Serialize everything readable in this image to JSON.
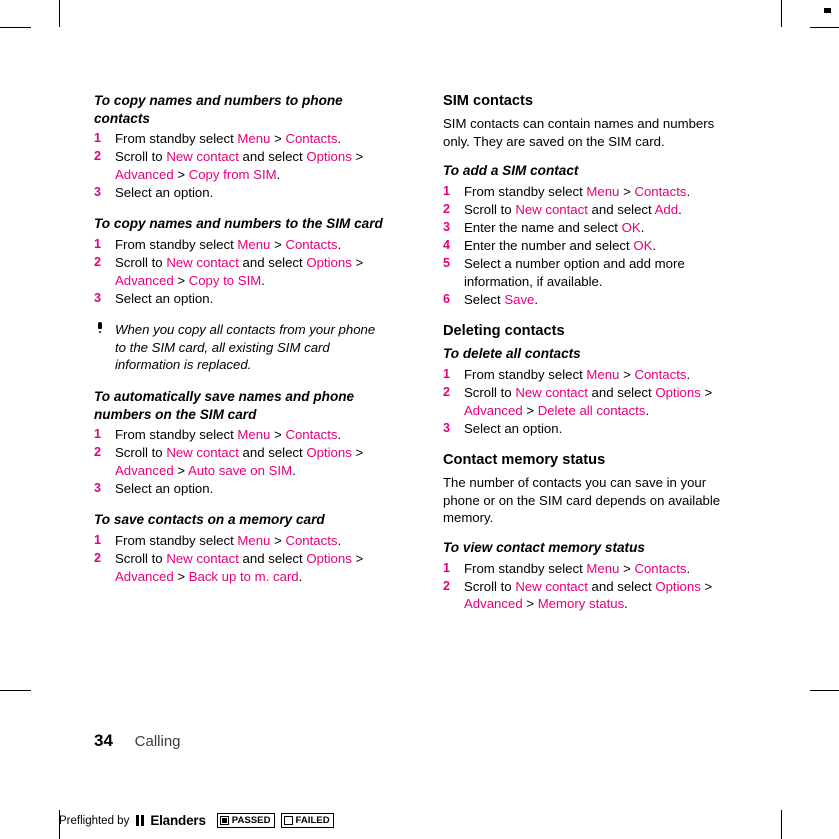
{
  "page": {
    "number": "34",
    "section": "Calling"
  },
  "left_column": {
    "blocks": [
      {
        "type": "h3",
        "text": "To copy names and numbers to phone contacts"
      },
      {
        "type": "steps",
        "items": [
          [
            {
              "t": "From standby select "
            },
            {
              "t": "Menu",
              "m": true
            },
            {
              "t": " > "
            },
            {
              "t": "Contacts",
              "m": true
            },
            {
              "t": "."
            }
          ],
          [
            {
              "t": "Scroll to "
            },
            {
              "t": "New contact",
              "m": true
            },
            {
              "t": " and select "
            },
            {
              "t": "Options",
              "m": true
            },
            {
              "t": " > "
            },
            {
              "t": "Advanced",
              "m": true
            },
            {
              "t": " > "
            },
            {
              "t": "Copy from SIM",
              "m": true
            },
            {
              "t": "."
            }
          ],
          [
            {
              "t": "Select an option."
            }
          ]
        ]
      },
      {
        "type": "h3",
        "text": "To copy names and numbers to the SIM card"
      },
      {
        "type": "steps",
        "items": [
          [
            {
              "t": "From standby select "
            },
            {
              "t": "Menu",
              "m": true
            },
            {
              "t": " > "
            },
            {
              "t": "Contacts",
              "m": true
            },
            {
              "t": "."
            }
          ],
          [
            {
              "t": "Scroll to "
            },
            {
              "t": "New contact",
              "m": true
            },
            {
              "t": " and select "
            },
            {
              "t": "Options",
              "m": true
            },
            {
              "t": " > "
            },
            {
              "t": "Advanced",
              "m": true
            },
            {
              "t": " > "
            },
            {
              "t": "Copy to SIM",
              "m": true
            },
            {
              "t": "."
            }
          ],
          [
            {
              "t": "Select an option."
            }
          ]
        ]
      },
      {
        "type": "note",
        "text": "When you copy all contacts from your phone to the SIM card, all existing SIM card information is replaced."
      },
      {
        "type": "h3",
        "text": "To automatically save names and phone numbers on the SIM card"
      },
      {
        "type": "steps",
        "items": [
          [
            {
              "t": "From standby select "
            },
            {
              "t": "Menu",
              "m": true
            },
            {
              "t": " > "
            },
            {
              "t": "Contacts",
              "m": true
            },
            {
              "t": "."
            }
          ],
          [
            {
              "t": "Scroll to "
            },
            {
              "t": "New contact",
              "m": true
            },
            {
              "t": " and select "
            },
            {
              "t": "Options",
              "m": true
            },
            {
              "t": " > "
            },
            {
              "t": "Advanced",
              "m": true
            },
            {
              "t": " > "
            },
            {
              "t": "Auto save on SIM",
              "m": true
            },
            {
              "t": "."
            }
          ],
          [
            {
              "t": "Select an option."
            }
          ]
        ]
      },
      {
        "type": "h3",
        "text": "To save contacts on a memory card"
      },
      {
        "type": "steps",
        "items": [
          [
            {
              "t": "From standby select "
            },
            {
              "t": "Menu",
              "m": true
            },
            {
              "t": " > "
            },
            {
              "t": "Contacts",
              "m": true
            },
            {
              "t": "."
            }
          ],
          [
            {
              "t": "Scroll to "
            },
            {
              "t": "New contact",
              "m": true
            },
            {
              "t": " and select "
            },
            {
              "t": "Options",
              "m": true
            },
            {
              "t": " > "
            },
            {
              "t": "Advanced",
              "m": true
            },
            {
              "t": " > "
            },
            {
              "t": "Back up to m. card",
              "m": true
            },
            {
              "t": "."
            }
          ]
        ]
      }
    ]
  },
  "right_column": {
    "blocks": [
      {
        "type": "h2",
        "text": "SIM contacts"
      },
      {
        "type": "para",
        "text": "SIM contacts can contain names and numbers only. They are saved on the SIM card."
      },
      {
        "type": "h3",
        "text": "To add a SIM contact"
      },
      {
        "type": "steps",
        "items": [
          [
            {
              "t": "From standby select "
            },
            {
              "t": "Menu",
              "m": true
            },
            {
              "t": " > "
            },
            {
              "t": "Contacts",
              "m": true
            },
            {
              "t": "."
            }
          ],
          [
            {
              "t": "Scroll to "
            },
            {
              "t": "New contact",
              "m": true
            },
            {
              "t": " and select "
            },
            {
              "t": "Add",
              "m": true
            },
            {
              "t": "."
            }
          ],
          [
            {
              "t": "Enter the name and select "
            },
            {
              "t": "OK",
              "m": true
            },
            {
              "t": "."
            }
          ],
          [
            {
              "t": "Enter the number and select "
            },
            {
              "t": "OK",
              "m": true
            },
            {
              "t": "."
            }
          ],
          [
            {
              "t": "Select a number option and add more information, if available."
            }
          ],
          [
            {
              "t": "Select "
            },
            {
              "t": "Save",
              "m": true
            },
            {
              "t": "."
            }
          ]
        ]
      },
      {
        "type": "h2",
        "text": "Deleting contacts"
      },
      {
        "type": "h3",
        "text": "To delete all contacts"
      },
      {
        "type": "steps",
        "items": [
          [
            {
              "t": "From standby select "
            },
            {
              "t": "Menu",
              "m": true
            },
            {
              "t": " > "
            },
            {
              "t": "Contacts",
              "m": true
            },
            {
              "t": "."
            }
          ],
          [
            {
              "t": "Scroll to "
            },
            {
              "t": "New contact",
              "m": true
            },
            {
              "t": " and select "
            },
            {
              "t": "Options",
              "m": true
            },
            {
              "t": " > "
            },
            {
              "t": "Advanced",
              "m": true
            },
            {
              "t": " > "
            },
            {
              "t": "Delete all contacts",
              "m": true
            },
            {
              "t": "."
            }
          ],
          [
            {
              "t": "Select an option."
            }
          ]
        ]
      },
      {
        "type": "h2",
        "text": "Contact memory status"
      },
      {
        "type": "para",
        "text": "The number of contacts you can save in your phone or on the SIM card depends on available memory."
      },
      {
        "type": "h3",
        "text": "To view contact memory status"
      },
      {
        "type": "steps",
        "items": [
          [
            {
              "t": "From standby select "
            },
            {
              "t": "Menu",
              "m": true
            },
            {
              "t": " > "
            },
            {
              "t": "Contacts",
              "m": true
            },
            {
              "t": "."
            }
          ],
          [
            {
              "t": "Scroll to "
            },
            {
              "t": "New contact",
              "m": true
            },
            {
              "t": " and select "
            },
            {
              "t": "Options",
              "m": true
            },
            {
              "t": " > "
            },
            {
              "t": "Advanced",
              "m": true
            },
            {
              "t": " > "
            },
            {
              "t": "Memory status",
              "m": true
            },
            {
              "t": "."
            }
          ]
        ]
      }
    ]
  },
  "preflight": {
    "label": "Preflighted by",
    "brand": "Elanders",
    "passed": "PASSED",
    "failed": "FAILED"
  },
  "colors": {
    "menu_accent": "#e5007d",
    "text": "#000000"
  }
}
